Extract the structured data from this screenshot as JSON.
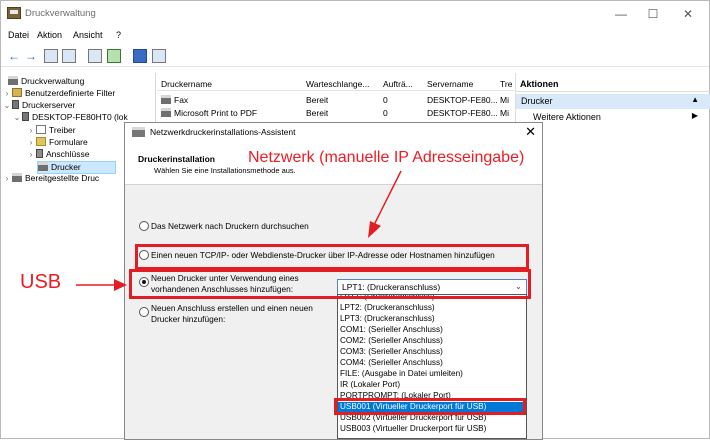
{
  "window": {
    "title": "Druckverwaltung",
    "minimize": "—",
    "maximize": "☐",
    "close": "✕"
  },
  "menu": [
    "Datei",
    "Aktion",
    "Ansicht",
    "?"
  ],
  "tree": {
    "items": [
      {
        "label": "Druckverwaltung",
        "level": 0
      },
      {
        "label": "Benutzerdefinierte Filter",
        "level": 1
      },
      {
        "label": "Druckerserver",
        "level": 1
      },
      {
        "label": "DESKTOP-FE80HT0 (lok",
        "level": 2
      },
      {
        "label": "Treiber",
        "level": 3
      },
      {
        "label": "Formulare",
        "level": 3
      },
      {
        "label": "Anschlüsse",
        "level": 3
      },
      {
        "label": "Drucker",
        "level": 3
      },
      {
        "label": "Bereitgestellte Druc",
        "level": 0
      }
    ]
  },
  "list": {
    "columns": [
      "Druckername",
      "Warteschlange...",
      "Aufträ...",
      "Servername",
      "Tre"
    ],
    "rows": [
      {
        "name": "Fax",
        "queue": "Bereit",
        "jobs": "0",
        "server": "DESKTOP-FE80...",
        "type": "Mi"
      },
      {
        "name": "Microsoft Print to PDF",
        "queue": "Bereit",
        "jobs": "0",
        "server": "DESKTOP-FE80...",
        "type": "Mi"
      }
    ]
  },
  "actions": {
    "title": "Aktionen",
    "section": "Drucker",
    "more": "Weitere Aktionen"
  },
  "dialog": {
    "title": "Netzwerkdruckerinstallations-Assistent",
    "close": "✕",
    "header_title": "Druckerinstallation",
    "header_sub": "Wählen Sie eine Installationsmethode aus.",
    "options": [
      "Das Netzwerk nach Druckern durchsuchen",
      "Einen neuen TCP/IP- oder Webdienste-Drucker über IP-Adresse oder Hostnamen hinzufügen",
      "Neuen Drucker unter Verwendung eines",
      "vorhandenen Anschlusses hinzufügen:",
      "Neuen Anschluss erstellen und einen neuen",
      "Drucker hinzufügen:"
    ],
    "selected_port": "LPT1: (Druckeranschluss)",
    "port_options": [
      "LPT1: (Druckeranschluss)",
      "LPT2: (Druckeranschluss)",
      "LPT3: (Druckeranschluss)",
      "COM1: (Serieller Anschluss)",
      "COM2: (Serieller Anschluss)",
      "COM3: (Serieller Anschluss)",
      "COM4: (Serieller Anschluss)",
      "FILE: (Ausgabe in Datei umleiten)",
      "IR (Lokaler Port)",
      "PORTPROMPT: (Lokaler Port)",
      "USB001 (Virtueller Druckerport für USB)",
      "USB002 (Virtueller Druckerport für USB)",
      "USB003 (Virtueller Druckerport für USB)"
    ]
  },
  "annotations": {
    "network": "Netzwerk (manuelle IP Adresseingabe)",
    "usb": "USB"
  },
  "colors": {
    "accent": "#0078d7",
    "annotation_red": "#e41d24",
    "selection": "#cce8ff"
  }
}
